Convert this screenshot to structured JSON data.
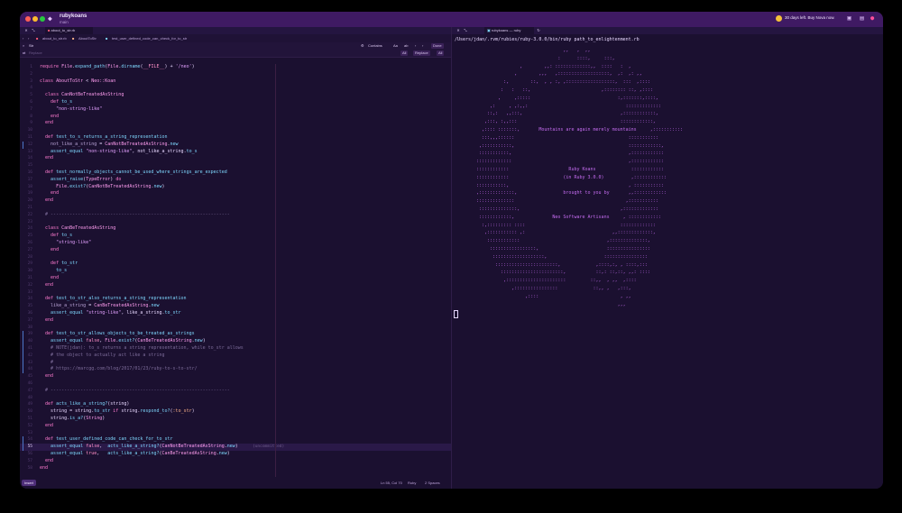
{
  "window": {
    "project_name": "rubykoans",
    "project_subtitle": "main",
    "trial_text": "30 days left. Buy Nova now.",
    "colors": {
      "titlebar": "#3f1a63",
      "background": "#1b1030",
      "accent": "#ff7bd0"
    }
  },
  "editor": {
    "tabs": [
      {
        "label": "about_to_str.rb",
        "active": true
      }
    ],
    "breadcrumbs": [
      "about_to_str.rb",
      "AboutToStr",
      "test_user_defined_code_can_check_for_to_str"
    ],
    "find": {
      "query": "Str",
      "contains_label": "Contains",
      "match_case": "Aa",
      "regex": "ab",
      "prev": "‹",
      "next": "›",
      "done_label": "Done",
      "replace_placeholder": "Replace",
      "all_label": "All",
      "replace_label": "Replace",
      "replace_all_label": "All"
    },
    "lines": [
      [
        {
          "c": "kw",
          "t": "require "
        },
        {
          "c": "ty",
          "t": "File"
        },
        {
          "t": "."
        },
        {
          "c": "fn",
          "t": "expand_path"
        },
        {
          "t": "("
        },
        {
          "c": "ty",
          "t": "File"
        },
        {
          "t": "."
        },
        {
          "c": "fn",
          "t": "dirname"
        },
        {
          "t": "("
        },
        {
          "c": "cst",
          "t": "__FILE__"
        },
        {
          "t": ") + "
        },
        {
          "c": "st",
          "t": "'/neo'"
        },
        {
          "t": ")"
        }
      ],
      [],
      [
        {
          "c": "kw",
          "t": "class "
        },
        {
          "c": "ty",
          "t": "AboutToStr"
        },
        {
          "t": " < "
        },
        {
          "c": "ty",
          "t": "Neo::Koan"
        }
      ],
      [],
      [
        {
          "t": "  "
        },
        {
          "c": "kw",
          "t": "class "
        },
        {
          "c": "ty",
          "t": "CanNotBeTreatedAsString"
        }
      ],
      [
        {
          "t": "    "
        },
        {
          "c": "kw",
          "t": "def "
        },
        {
          "c": "fn",
          "t": "to_s"
        }
      ],
      [
        {
          "t": "      "
        },
        {
          "c": "st",
          "t": "\"non-string-like\""
        }
      ],
      [
        {
          "t": "    "
        },
        {
          "c": "kw",
          "t": "end"
        }
      ],
      [
        {
          "t": "  "
        },
        {
          "c": "kw",
          "t": "end"
        }
      ],
      [],
      [
        {
          "t": "  "
        },
        {
          "c": "kw",
          "t": "def "
        },
        {
          "c": "fn",
          "t": "test_to_s_returns_a_string_representation"
        }
      ],
      [
        {
          "t": "    "
        },
        {
          "c": "dim",
          "t": "not_like_a_string"
        },
        {
          "t": " = "
        },
        {
          "c": "ty",
          "t": "CanNotBeTreatedAsString"
        },
        {
          "t": "."
        },
        {
          "c": "fn",
          "t": "new"
        }
      ],
      [
        {
          "t": "    "
        },
        {
          "c": "fn",
          "t": "assert_equal "
        },
        {
          "c": "st",
          "t": "\"non-string-like\""
        },
        {
          "t": ", not_like_a_string."
        },
        {
          "c": "fn",
          "t": "to_s"
        }
      ],
      [
        {
          "t": "  "
        },
        {
          "c": "kw",
          "t": "end"
        }
      ],
      [],
      [
        {
          "t": "  "
        },
        {
          "c": "kw",
          "t": "def "
        },
        {
          "c": "fn",
          "t": "test_normally_objects_cannot_be_used_where_strings_are_expected"
        }
      ],
      [
        {
          "t": "    "
        },
        {
          "c": "fn",
          "t": "assert_raise"
        },
        {
          "t": "("
        },
        {
          "c": "ty",
          "t": "TypeError"
        },
        {
          "t": ") "
        },
        {
          "c": "kw",
          "t": "do"
        }
      ],
      [
        {
          "t": "      "
        },
        {
          "c": "ty",
          "t": "File"
        },
        {
          "t": "."
        },
        {
          "c": "fn",
          "t": "exist?"
        },
        {
          "t": "("
        },
        {
          "c": "ty",
          "t": "CanNotBeTreatedAsString"
        },
        {
          "t": "."
        },
        {
          "c": "fn",
          "t": "new"
        },
        {
          "t": ")"
        }
      ],
      [
        {
          "t": "    "
        },
        {
          "c": "kw",
          "t": "end"
        }
      ],
      [
        {
          "t": "  "
        },
        {
          "c": "kw",
          "t": "end"
        }
      ],
      [],
      [
        {
          "t": "  "
        },
        {
          "c": "cm",
          "t": "# ------------------------------------------------------------------"
        }
      ],
      [],
      [
        {
          "t": "  "
        },
        {
          "c": "kw",
          "t": "class "
        },
        {
          "c": "ty",
          "t": "CanBeTreatedAsString"
        }
      ],
      [
        {
          "t": "    "
        },
        {
          "c": "kw",
          "t": "def "
        },
        {
          "c": "fn",
          "t": "to_s"
        }
      ],
      [
        {
          "t": "      "
        },
        {
          "c": "st",
          "t": "\"string-like\""
        }
      ],
      [
        {
          "t": "    "
        },
        {
          "c": "kw",
          "t": "end"
        }
      ],
      [],
      [
        {
          "t": "    "
        },
        {
          "c": "kw",
          "t": "def "
        },
        {
          "c": "fn",
          "t": "to_str"
        }
      ],
      [
        {
          "t": "      "
        },
        {
          "c": "fn",
          "t": "to_s"
        }
      ],
      [
        {
          "t": "    "
        },
        {
          "c": "kw",
          "t": "end"
        }
      ],
      [
        {
          "t": "  "
        },
        {
          "c": "kw",
          "t": "end"
        }
      ],
      [],
      [
        {
          "t": "  "
        },
        {
          "c": "kw",
          "t": "def "
        },
        {
          "c": "fn",
          "t": "test_to_str_also_returns_a_string_representation"
        }
      ],
      [
        {
          "t": "    "
        },
        {
          "c": "dim",
          "t": "like_a_string"
        },
        {
          "t": " = "
        },
        {
          "c": "ty",
          "t": "CanBeTreatedAsString"
        },
        {
          "t": "."
        },
        {
          "c": "fn",
          "t": "new"
        }
      ],
      [
        {
          "t": "    "
        },
        {
          "c": "fn",
          "t": "assert_equal "
        },
        {
          "c": "st",
          "t": "\"string-like\""
        },
        {
          "t": ", like_a_string."
        },
        {
          "c": "fn",
          "t": "to_str"
        }
      ],
      [
        {
          "t": "  "
        },
        {
          "c": "kw",
          "t": "end"
        }
      ],
      [],
      [
        {
          "t": "  "
        },
        {
          "c": "kw",
          "t": "def "
        },
        {
          "c": "fn",
          "t": "test_to_str_allows_objects_to_be_treated_as_strings"
        }
      ],
      [
        {
          "t": "    "
        },
        {
          "c": "fn",
          "t": "assert_equal "
        },
        {
          "c": "cst",
          "t": "false"
        },
        {
          "t": ", "
        },
        {
          "c": "ty",
          "t": "File"
        },
        {
          "t": "."
        },
        {
          "c": "fn",
          "t": "exist?"
        },
        {
          "t": "("
        },
        {
          "c": "ty",
          "t": "CanBeTreatedAsString"
        },
        {
          "t": "."
        },
        {
          "c": "fn",
          "t": "new"
        },
        {
          "t": ")"
        }
      ],
      [
        {
          "t": "    "
        },
        {
          "c": "cm",
          "t": "# NOTE(jdan): to_s returns a string representation, while to_str allows"
        }
      ],
      [
        {
          "t": "    "
        },
        {
          "c": "cm",
          "t": "# the object to actually act like a string"
        }
      ],
      [
        {
          "t": "    "
        },
        {
          "c": "cm",
          "t": "#"
        }
      ],
      [
        {
          "t": "    "
        },
        {
          "c": "cm",
          "t": "# https://marcgg.com/blog/2017/01/23/ruby-to-s-to-str/"
        }
      ],
      [
        {
          "t": "  "
        },
        {
          "c": "kw",
          "t": "end"
        }
      ],
      [],
      [
        {
          "t": "  "
        },
        {
          "c": "cm",
          "t": "# ------------------------------------------------------------------"
        }
      ],
      [],
      [
        {
          "t": "  "
        },
        {
          "c": "kw",
          "t": "def "
        },
        {
          "c": "fn",
          "t": "acts_like_a_string?"
        },
        {
          "t": "(string)"
        }
      ],
      [
        {
          "t": "    string = string."
        },
        {
          "c": "fn",
          "t": "to_str "
        },
        {
          "c": "kw",
          "t": "if "
        },
        {
          "t": "string."
        },
        {
          "c": "fn",
          "t": "respond_to?"
        },
        {
          "t": "("
        },
        {
          "c": "sy",
          "t": ":to_str"
        },
        {
          "t": ")"
        }
      ],
      [
        {
          "t": "    string."
        },
        {
          "c": "fn",
          "t": "is_a?"
        },
        {
          "t": "("
        },
        {
          "c": "ty",
          "t": "String"
        },
        {
          "t": ")"
        }
      ],
      [
        {
          "t": "  "
        },
        {
          "c": "kw",
          "t": "end"
        }
      ],
      [],
      [
        {
          "t": "  "
        },
        {
          "c": "kw",
          "t": "def "
        },
        {
          "c": "fn",
          "t": "test_user_defined_code_can_check_for_to_str"
        }
      ],
      [
        {
          "t": "    "
        },
        {
          "c": "fn",
          "t": "assert_equal "
        },
        {
          "c": "cst",
          "t": "false"
        },
        {
          "t": ",  "
        },
        {
          "c": "fn",
          "t": "acts_like_a_string?"
        },
        {
          "t": "("
        },
        {
          "c": "ty",
          "t": "CanNotBeTreatedAsString"
        },
        {
          "t": "."
        },
        {
          "c": "fn",
          "t": "new"
        },
        {
          "t": ")"
        }
      ],
      [
        {
          "t": "    "
        },
        {
          "c": "fn",
          "t": "assert_equal "
        },
        {
          "c": "cst",
          "t": "true"
        },
        {
          "t": ",   "
        },
        {
          "c": "fn",
          "t": "acts_like_a_string?"
        },
        {
          "t": "("
        },
        {
          "c": "ty",
          "t": "CanBeTreatedAsString"
        },
        {
          "t": "."
        },
        {
          "c": "fn",
          "t": "new"
        },
        {
          "t": ")"
        }
      ],
      [
        {
          "t": "  "
        },
        {
          "c": "kw",
          "t": "end"
        }
      ],
      [
        {
          "c": "kw",
          "t": "end"
        }
      ]
    ],
    "current_line": 55,
    "ghost_text": "(uncommitted)",
    "status": {
      "mode": "Insert",
      "position": "Ln 55, Col 70",
      "language": "Ruby",
      "indent": "2 Spaces"
    }
  },
  "terminal": {
    "tab_label": "rubykoans — ruby",
    "path": "/Users/jdan/.rvm/rubies/ruby-3.0.0/bin/ruby path_to_enlightenment.rb",
    "art_lines": [
      "                                        ,,   ,  ,,",
      "                                      :      ::::,     :::,",
      "                        ,        ,,: :::::::::::::,,  ::::   :  ,",
      "                      ,        ,,,   ,:::::::::::::::::::,  ,:  ,: ,,",
      "                  :,        ::,  , , :, ,::::::::::::::::::,  :::  ,::::",
      "                 :   :   ::,                          ,:::::::: ::, ,::::",
      "                ,     ,:::::                                :,:::::::,::::,",
      "             ,:     , ,:,,:                                    :::::::::::::",
      "            ::,:   ,,:::,                                    ,::::::::::::,",
      "           ,:::, :,,:::                                      ::::::::::::,",
      "          ,:::: :::::::,       Mountains are again merely mountains     ,:::::::::::",
      "          :::,,,::::::                                          :::::::::::",
      "         ,:::::::::::,                                          ::::::::::::,",
      "         :::::::::::,                                           ,::::::::::::",
      "        :::::::::::::                                           ,::::::::::::",
      "        ::::::::::::                      Ruby Koans             ::::::::::::",
      "        ::::::::::::                    (in Ruby 3.0.0)          ,::::::::::::",
      "        :::::::::::,                                            , :::::::::::",
      "        ,:::::::::::::,                 brought to you by       ,,::::::::::::",
      "        ::::::::::::::                                         ,:::::::::::",
      "         ::::::::::::::,                                     ,:::::::::::::",
      "         ::::::::::::,              Neo Software Artisans     , ::::::::::::",
      "          :,::::::::: ::::                                   :::::::::::::",
      "           ,::::::::::: ,:                                ,,:::::::::::::,",
      "            ::::::::::::                                ,::::::::::::::,",
      "             :::::::::::::::::,                         ::::::::::::::::",
      "              :::::::::::::::::::,                     ::::::::::::::::",
      "               :::::::::::::::::::::::,             ,::::,:, , ::::,:::",
      "                 :::::::::::::::::::::::,           ::,: ::,::, ,,: ::::",
      "                  ,::::::::::::::::::::::         ::,,  , ,,  ,::::",
      "                     ,::::::::::::::::             ::,, ,   ,:::,",
      "                          ,::::                              , ,,",
      "                                                            ,,,"
    ],
    "colors": {
      "art": "#c56cf0",
      "path": "#e8d8ff"
    }
  }
}
